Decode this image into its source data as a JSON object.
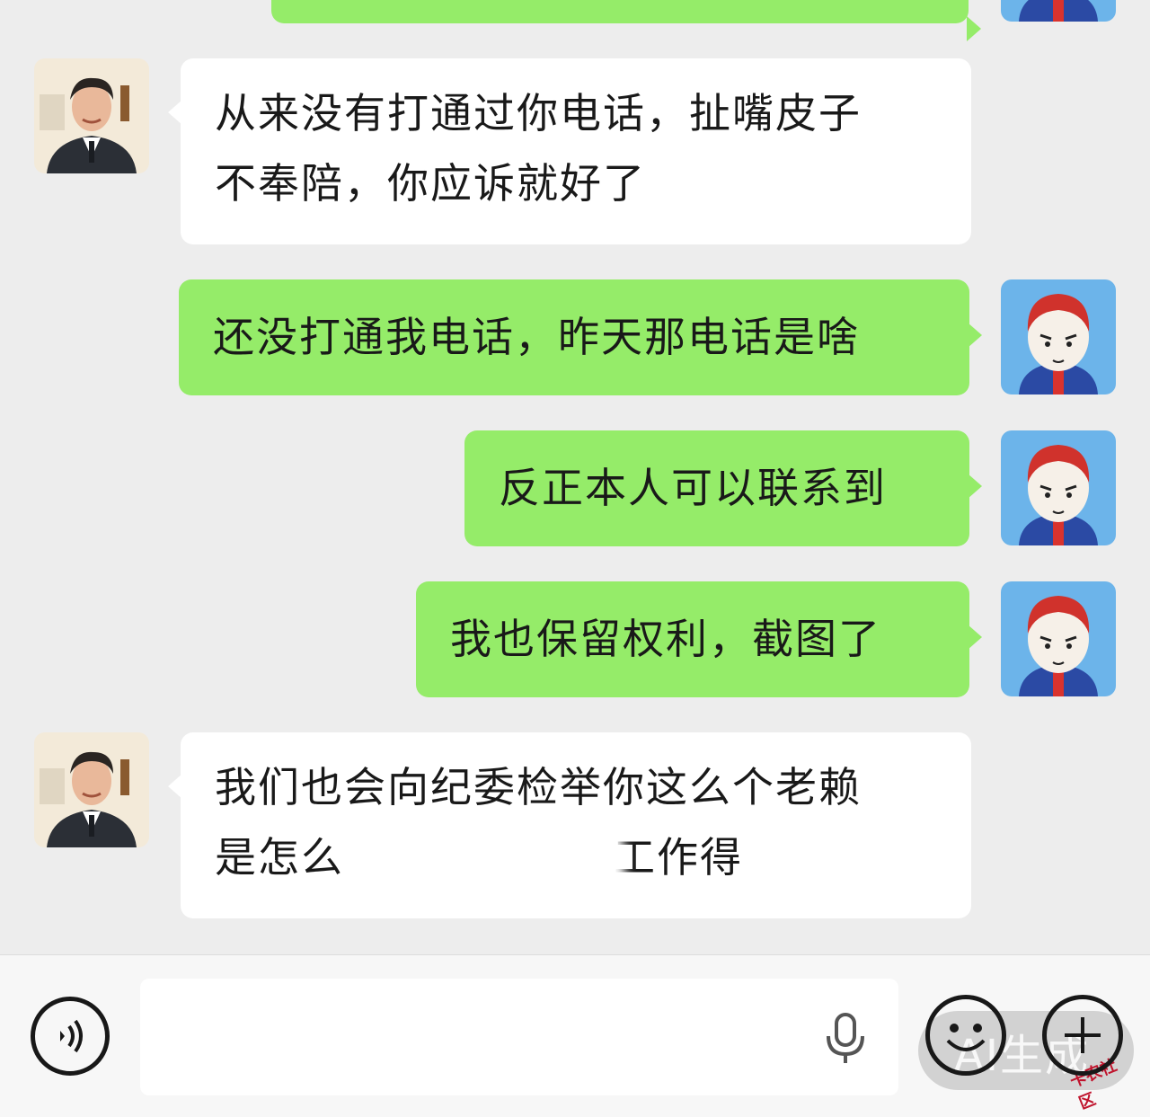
{
  "messages": [
    {
      "side": "in",
      "text_line1": "从来没有打通过你电话，扯嘴皮子",
      "text_line2": "不奉陪，你应诉就好了"
    },
    {
      "side": "out",
      "text": "还没打通我电话，昨天那电话是啥"
    },
    {
      "side": "out",
      "text": "反正本人可以联系到"
    },
    {
      "side": "out",
      "text": "我也保留权利，截图了"
    },
    {
      "side": "in",
      "text_line1": "我们也会向纪委检举你这么个老赖",
      "text_line2_start": "是怎么",
      "text_line2_end": "工作得"
    }
  ],
  "input_bar": {
    "placeholder": "",
    "icons": [
      "voice-icon",
      "microphone-icon",
      "emoji-icon",
      "plus-icon"
    ]
  },
  "watermark": {
    "text": "AI生成",
    "logo_text": "卡农社区"
  },
  "colors": {
    "background": "#ededed",
    "incoming": "#ffffff",
    "outgoing": "#95ec69"
  }
}
